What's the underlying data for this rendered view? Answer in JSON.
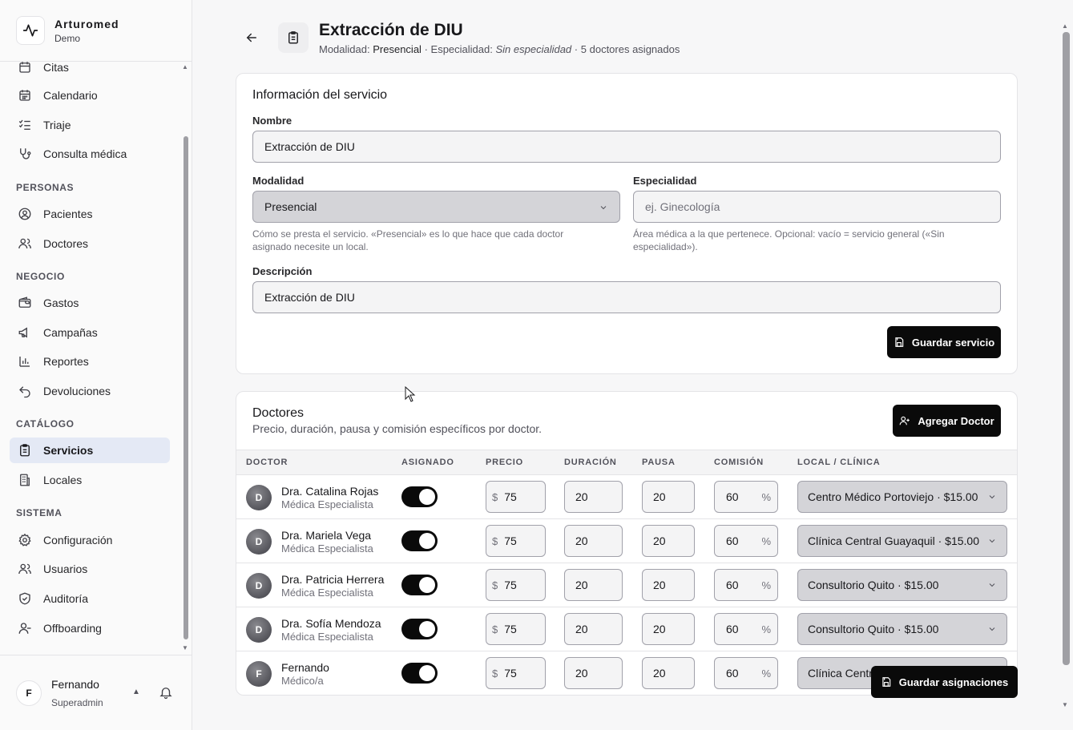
{
  "brand": {
    "name": "Arturomed",
    "sub": "Demo"
  },
  "sidebar": {
    "items": [
      {
        "label": "Citas",
        "icon": "calendar-icon"
      },
      {
        "label": "Calendario",
        "icon": "calendar-grid-icon"
      },
      {
        "label": "Triaje",
        "icon": "list-checks-icon"
      },
      {
        "label": "Consulta médica",
        "icon": "stethoscope-icon"
      },
      {
        "label": "Pacientes",
        "icon": "user-circle-icon"
      },
      {
        "label": "Doctores",
        "icon": "users-icon"
      },
      {
        "label": "Gastos",
        "icon": "wallet-icon"
      },
      {
        "label": "Campañas",
        "icon": "megaphone-icon"
      },
      {
        "label": "Reportes",
        "icon": "bar-chart-icon"
      },
      {
        "label": "Devoluciones",
        "icon": "undo-icon"
      },
      {
        "label": "Servicios",
        "icon": "clipboard-icon"
      },
      {
        "label": "Locales",
        "icon": "building-icon"
      },
      {
        "label": "Configuración",
        "icon": "gear-icon"
      },
      {
        "label": "Usuarios",
        "icon": "users-icon"
      },
      {
        "label": "Auditoría",
        "icon": "shield-check-icon"
      },
      {
        "label": "Offboarding",
        "icon": "user-minus-icon"
      }
    ],
    "sections": [
      "PERSONAS",
      "NEGOCIO",
      "CATÁLOGO",
      "SISTEMA"
    ]
  },
  "user": {
    "initial": "F",
    "name": "Fernando",
    "role": "Superadmin"
  },
  "header": {
    "title": "Extracción de DIU",
    "modalidad_label": "Modalidad:",
    "modalidad_value": "Presencial",
    "especialidad_label": "Especialidad:",
    "especialidad_value": "Sin especialidad",
    "doctores_count": "5 doctores asignados",
    "sep": "·"
  },
  "service_form": {
    "title": "Información del servicio",
    "nombre_label": "Nombre",
    "nombre_value": "Extracción de DIU",
    "modalidad_label": "Modalidad",
    "modalidad_value": "Presencial",
    "modalidad_hint": "Cómo se presta el servicio. «Presencial» es lo que hace que cada doctor asignado necesite un local.",
    "especialidad_label": "Especialidad",
    "especialidad_placeholder": "ej. Ginecología",
    "especialidad_hint": "Área médica a la que pertenece. Opcional: vacío = servicio general («Sin especialidad»).",
    "descripcion_label": "Descripción",
    "descripcion_value": "Extracción de DIU",
    "save_label": "Guardar servicio"
  },
  "doctors": {
    "title": "Doctores",
    "subtitle": "Precio, duración, pausa y comisión específicos por doctor.",
    "add_label": "Agregar Doctor",
    "columns": [
      "DOCTOR",
      "ASIGNADO",
      "PRECIO",
      "DURACIÓN",
      "PAUSA",
      "COMISIÓN",
      "LOCAL / CLÍNICA"
    ],
    "currency": "$",
    "percent": "%",
    "rows": [
      {
        "initial": "D",
        "name": "Dra. Catalina Rojas",
        "role": "Médica Especialista",
        "assigned": true,
        "price": "75",
        "duration": "20",
        "pause": "20",
        "commission": "60",
        "local": "Centro Médico Portoviejo · $15.00"
      },
      {
        "initial": "D",
        "name": "Dra. Mariela Vega",
        "role": "Médica Especialista",
        "assigned": true,
        "price": "75",
        "duration": "20",
        "pause": "20",
        "commission": "60",
        "local": "Clínica Central Guayaquil · $15.00"
      },
      {
        "initial": "D",
        "name": "Dra. Patricia Herrera",
        "role": "Médica Especialista",
        "assigned": true,
        "price": "75",
        "duration": "20",
        "pause": "20",
        "commission": "60",
        "local": "Consultorio Quito · $15.00"
      },
      {
        "initial": "D",
        "name": "Dra. Sofía Mendoza",
        "role": "Médica Especialista",
        "assigned": true,
        "price": "75",
        "duration": "20",
        "pause": "20",
        "commission": "60",
        "local": "Consultorio Quito · $15.00"
      },
      {
        "initial": "F",
        "name": "Fernando",
        "role": "Médico/a",
        "assigned": true,
        "price": "75",
        "duration": "20",
        "pause": "20",
        "commission": "60",
        "local": "Clínica Centr"
      }
    ],
    "save_assign_label": "Guardar asignaciones"
  }
}
